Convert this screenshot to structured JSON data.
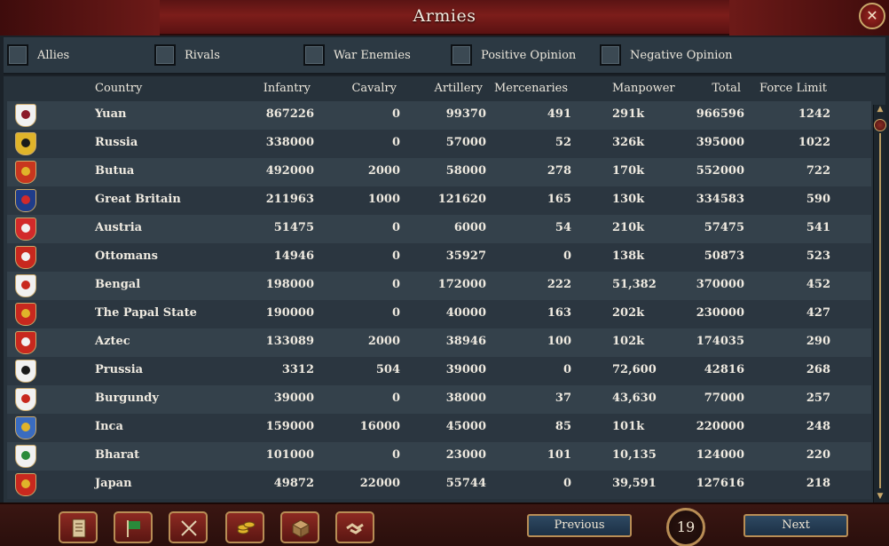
{
  "window": {
    "title": "Armies",
    "close_symbol": "✕"
  },
  "filters": [
    {
      "label": "Allies"
    },
    {
      "label": "Rivals"
    },
    {
      "label": "War Enemies"
    },
    {
      "label": "Positive Opinion"
    },
    {
      "label": "Negative Opinion"
    }
  ],
  "columns": {
    "country": "Country",
    "infantry": "Infantry",
    "cavalry": "Cavalry",
    "artillery": "Artillery",
    "mercenaries": "Mercenaries",
    "manpower": "Manpower",
    "total": "Total",
    "force_limit": "Force Limit"
  },
  "rows": [
    {
      "country": "Yuan",
      "infantry": "867226",
      "cavalry": "0",
      "artillery": "99370",
      "mercenaries": "491",
      "manpower": "291k",
      "total": "966596",
      "force_limit": "1242",
      "flag_color": "#f1f1f1",
      "flag_accent": "#8b1a2a"
    },
    {
      "country": "Russia",
      "infantry": "338000",
      "cavalry": "0",
      "artillery": "57000",
      "mercenaries": "52",
      "manpower": "326k",
      "total": "395000",
      "force_limit": "1022",
      "flag_color": "#e0b42a",
      "flag_accent": "#1a1a1a"
    },
    {
      "country": "Butua",
      "infantry": "492000",
      "cavalry": "2000",
      "artillery": "58000",
      "mercenaries": "278",
      "manpower": "170k",
      "total": "552000",
      "force_limit": "722",
      "flag_color": "#c8361e",
      "flag_accent": "#e0b42a"
    },
    {
      "country": "Great Britain",
      "infantry": "211963",
      "cavalry": "1000",
      "artillery": "121620",
      "mercenaries": "165",
      "manpower": "130k",
      "total": "334583",
      "force_limit": "590",
      "flag_color": "#1f3c8a",
      "flag_accent": "#d22a2a"
    },
    {
      "country": "Austria",
      "infantry": "51475",
      "cavalry": "0",
      "artillery": "6000",
      "mercenaries": "54",
      "manpower": "210k",
      "total": "57475",
      "force_limit": "541",
      "flag_color": "#d22a2a",
      "flag_accent": "#f1f1f1"
    },
    {
      "country": "Ottomans",
      "infantry": "14946",
      "cavalry": "0",
      "artillery": "35927",
      "mercenaries": "0",
      "manpower": "138k",
      "total": "50873",
      "force_limit": "523",
      "flag_color": "#c8281e",
      "flag_accent": "#f1f1f1"
    },
    {
      "country": "Bengal",
      "infantry": "198000",
      "cavalry": "0",
      "artillery": "172000",
      "mercenaries": "222",
      "manpower": "51,382",
      "total": "370000",
      "force_limit": "452",
      "flag_color": "#f1f1f1",
      "flag_accent": "#c8281e"
    },
    {
      "country": "The Papal State",
      "infantry": "190000",
      "cavalry": "0",
      "artillery": "40000",
      "mercenaries": "163",
      "manpower": "202k",
      "total": "230000",
      "force_limit": "427",
      "flag_color": "#c8281e",
      "flag_accent": "#e0b42a"
    },
    {
      "country": "Aztec",
      "infantry": "133089",
      "cavalry": "2000",
      "artillery": "38946",
      "mercenaries": "100",
      "manpower": "102k",
      "total": "174035",
      "force_limit": "290",
      "flag_color": "#c8281e",
      "flag_accent": "#f1f1f1"
    },
    {
      "country": "Prussia",
      "infantry": "3312",
      "cavalry": "504",
      "artillery": "39000",
      "mercenaries": "0",
      "manpower": "72,600",
      "total": "42816",
      "force_limit": "268",
      "flag_color": "#f1f1f1",
      "flag_accent": "#1a1a1a"
    },
    {
      "country": "Burgundy",
      "infantry": "39000",
      "cavalry": "0",
      "artillery": "38000",
      "mercenaries": "37",
      "manpower": "43,630",
      "total": "77000",
      "force_limit": "257",
      "flag_color": "#f1f1f1",
      "flag_accent": "#c8281e"
    },
    {
      "country": "Inca",
      "infantry": "159000",
      "cavalry": "16000",
      "artillery": "45000",
      "mercenaries": "85",
      "manpower": "101k",
      "total": "220000",
      "force_limit": "248",
      "flag_color": "#3a6cc0",
      "flag_accent": "#e0b42a"
    },
    {
      "country": "Bharat",
      "infantry": "101000",
      "cavalry": "0",
      "artillery": "23000",
      "mercenaries": "101",
      "manpower": "10,135",
      "total": "124000",
      "force_limit": "220",
      "flag_color": "#f1f1f1",
      "flag_accent": "#2a8a3a"
    },
    {
      "country": "Japan",
      "infantry": "49872",
      "cavalry": "22000",
      "artillery": "55744",
      "mercenaries": "0",
      "manpower": "39,591",
      "total": "127616",
      "force_limit": "218",
      "flag_color": "#c8281e",
      "flag_accent": "#e0b42a"
    }
  ],
  "toolbar": {
    "icons": [
      "ledger-icon",
      "flag-icon",
      "crossed-swords-icon",
      "coins-icon",
      "crate-icon",
      "handshake-icon"
    ]
  },
  "pagination": {
    "previous_label": "Previous",
    "next_label": "Next",
    "page": "19"
  },
  "scrollbar": {
    "up_symbol": "▲",
    "down_symbol": "▼"
  }
}
